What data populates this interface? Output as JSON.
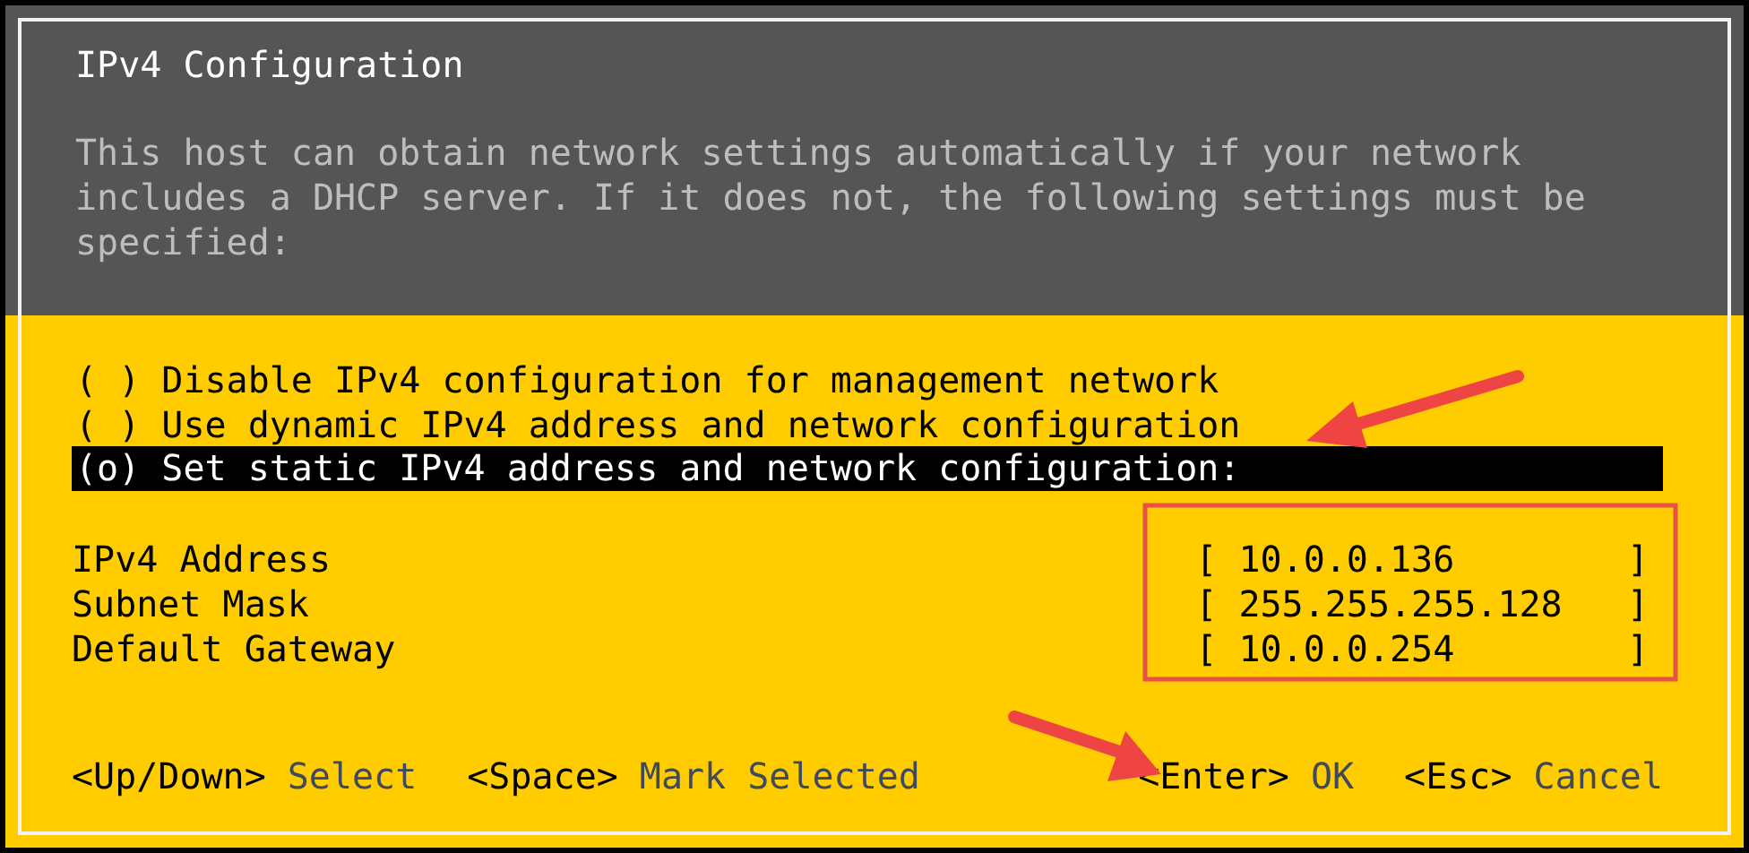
{
  "dialog": {
    "title": "IPv4 Configuration",
    "description": "This host can obtain network settings automatically if your network includes a DHCP server. If it does not, the following settings must be specified:"
  },
  "options": [
    {
      "marker": "( )",
      "label": "Disable IPv4 configuration for management network",
      "selected": false
    },
    {
      "marker": "( )",
      "label": "Use dynamic IPv4 address and network configuration",
      "selected": false
    },
    {
      "marker": "(o)",
      "label": "Set static IPv4 address and network configuration:",
      "selected": true
    }
  ],
  "fields": [
    {
      "label": "IPv4 Address",
      "value": "[ 10.0.0.136        ]"
    },
    {
      "label": "Subnet Mask",
      "value": "[ 255.255.255.128   ]"
    },
    {
      "label": "Default Gateway",
      "value": "[ 10.0.0.254        ]"
    }
  ],
  "footer": {
    "left_hints": [
      {
        "key": "<Up/Down>",
        "action": "Select"
      },
      {
        "key": "<Space>",
        "action": "Mark Selected"
      }
    ],
    "right_hints": [
      {
        "key": "<Enter>",
        "action": "OK"
      },
      {
        "key": "<Esc>",
        "action": "Cancel"
      }
    ]
  }
}
